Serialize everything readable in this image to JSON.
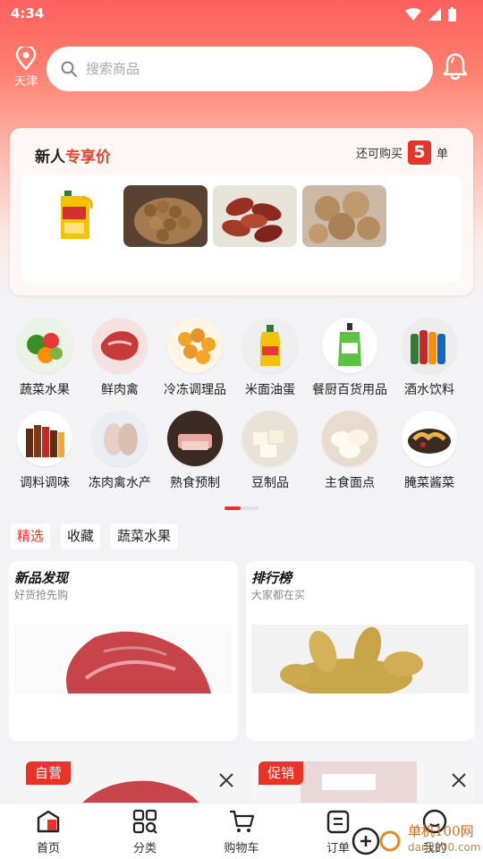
{
  "status": {
    "time": "4:34"
  },
  "header": {
    "city": "天津",
    "search_placeholder": "搜索商品"
  },
  "newuser": {
    "title_prefix": "新人",
    "title_highlight": "专享价",
    "quota_prefix": "还可购买",
    "quota_count": "5",
    "quota_suffix": "单"
  },
  "categories": [
    {
      "label": "蔬菜水果",
      "icon": "vegetables-icon"
    },
    {
      "label": "鲜肉禽",
      "icon": "meat-icon"
    },
    {
      "label": "冷冻调理品",
      "icon": "frozen-food-icon"
    },
    {
      "label": "米面油蛋",
      "icon": "oil-icon"
    },
    {
      "label": "餐厨百货用品",
      "icon": "detergent-icon"
    },
    {
      "label": "酒水饮料",
      "icon": "drinks-icon"
    },
    {
      "label": "调料调味",
      "icon": "seasoning-icon"
    },
    {
      "label": "冻肉禽水产",
      "icon": "frozen-meat-icon"
    },
    {
      "label": "熟食预制",
      "icon": "cooked-food-icon"
    },
    {
      "label": "豆制品",
      "icon": "tofu-icon"
    },
    {
      "label": "主食面点",
      "icon": "bun-icon"
    },
    {
      "label": "腌菜酱菜",
      "icon": "pickles-icon"
    }
  ],
  "tabs": [
    {
      "label": "精选",
      "active": true
    },
    {
      "label": "收藏",
      "active": false
    },
    {
      "label": "蔬菜水果",
      "active": false
    }
  ],
  "features": [
    {
      "title": "新品发现",
      "subtitle": "好货抢先购"
    },
    {
      "title": "排行榜",
      "subtitle": "大家都在买"
    }
  ],
  "products": [
    {
      "badge": "自营"
    },
    {
      "badge": "促销"
    }
  ],
  "tabbar": [
    {
      "label": "首页",
      "icon": "home-icon"
    },
    {
      "label": "分类",
      "icon": "category-icon"
    },
    {
      "label": "购物车",
      "icon": "cart-icon"
    },
    {
      "label": "订单",
      "icon": "order-icon"
    },
    {
      "label": "我的",
      "icon": "profile-icon"
    }
  ],
  "watermark": {
    "line1": "单机100网",
    "line2": "danji100.com"
  },
  "colors": {
    "accent": "#e8322a",
    "hero_top": "#ff5f5f",
    "page_bg": "#f3f3f5"
  }
}
